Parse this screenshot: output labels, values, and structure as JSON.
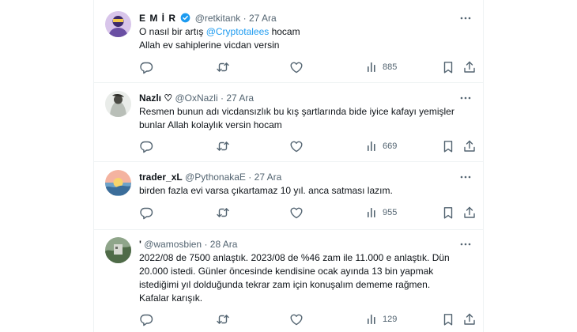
{
  "tweets": [
    {
      "name": "E M İ R",
      "verified": true,
      "handle": "@retkitank",
      "separator": "·",
      "date": "27 Ara",
      "text_pre": "O nasıl bir artış ",
      "mention": "@Cryptotalees",
      "text_post": " hocam",
      "line2": "Allah ev sahiplerine vicdan versin",
      "views": "885"
    },
    {
      "name": "Nazlı ♡",
      "handle": "@OxNazli",
      "separator": "·",
      "date": "27 Ara",
      "lines": [
        "Resmen bunun adı vicdansızlık bu kış şartlarında bide iyice kafayı yemişler",
        "bunlar Allah kolaylık versin hocam"
      ],
      "views": "669"
    },
    {
      "name": "trader_xL",
      "handle": "@PythonakaE",
      "separator": "·",
      "date": "27 Ara",
      "lines": [
        "birden fazla evi varsa çıkartamaz 10 yıl. anca satması lazım."
      ],
      "views": "955"
    },
    {
      "name": "'",
      "handle": "@wamosbien",
      "separator": "·",
      "date": "28 Ara",
      "lines": [
        "2022/08 de 7500 anlaştık. 2023/08 de %46 zam ile 11.000 e anlaştık. Dün",
        "20.000 istedi. Günler öncesinde kendisine ocak ayında 13 bin yapmak",
        "istediğimi yıl dolduğunda tekrar zam için konuşalım dememe rağmen.",
        "Kafalar karışık."
      ],
      "views": "129"
    }
  ],
  "icons": {
    "more": "more-icon",
    "reply": "reply-icon",
    "retweet": "retweet-icon",
    "like": "like-icon",
    "views": "views-icon",
    "bookmark": "bookmark-icon",
    "share": "share-icon"
  },
  "colors": {
    "mention": "#1d9bf0",
    "muted": "#536471",
    "verified": "#1d9bf0",
    "border": "#eff3f4"
  }
}
